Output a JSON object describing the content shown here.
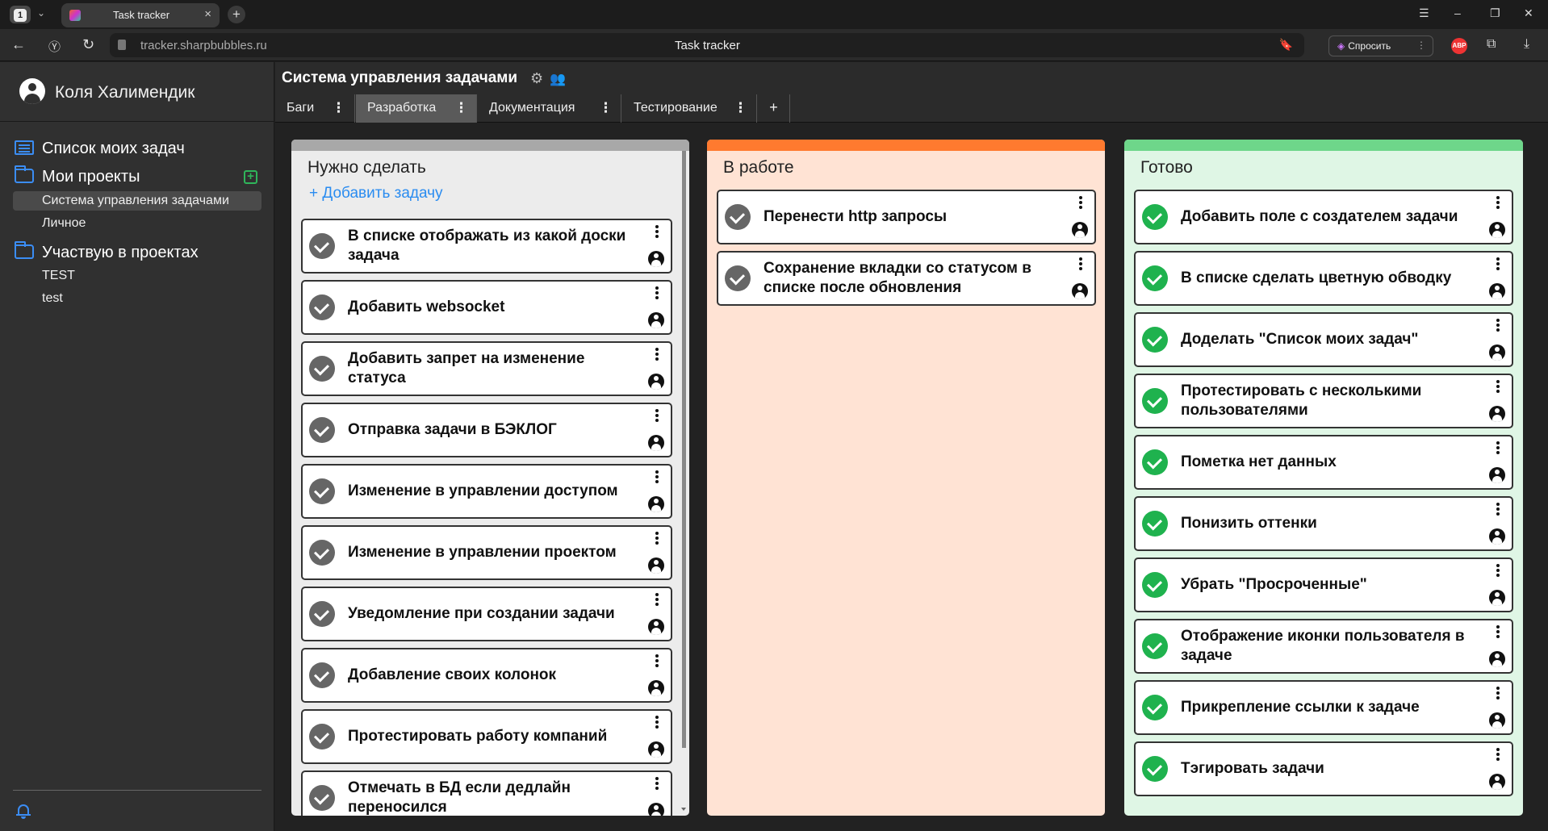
{
  "browser": {
    "tab_count": "1",
    "tab_title": "Task tracker",
    "url": "tracker.sharpbubbles.ru",
    "page_title": "Task tracker",
    "ask_button": "Спросить",
    "abp_badge": "ABP"
  },
  "sidebar": {
    "user_name": "Коля Халимендик",
    "my_tasks": "Список моих задач",
    "my_projects": "Мои проекты",
    "my_projects_items": [
      "Система управления задачами",
      "Личное"
    ],
    "participating": "Участвую в проектах",
    "participating_items": [
      "TEST",
      "test"
    ]
  },
  "header": {
    "project_title": "Система управления задачами",
    "tabs": [
      {
        "label": "Баги"
      },
      {
        "label": "Разработка"
      },
      {
        "label": "Документация"
      },
      {
        "label": "Тестирование"
      }
    ],
    "add_tab": "+",
    "active_tab": "Разработка"
  },
  "columns": [
    {
      "title": "Нужно сделать",
      "stripe_color": "#a8a8a8",
      "background": "#ececec",
      "add_task_label": "+ Добавить задачу",
      "check_color": "grey",
      "tasks": [
        "В списке отображать из какой доски задача",
        "Добавить websocket",
        "Добавить запрет на изменение статуса",
        "Отправка задачи в БЭКЛОГ",
        "Изменение в управлении доступом",
        "Изменение в управлении проектом",
        "Уведомление при создании задачи",
        "Добавление своих колонок",
        "Протестировать работу компаний",
        "Отмечать в БД если дедлайн переносился"
      ]
    },
    {
      "title": "В работе",
      "stripe_color": "#ff7a2f",
      "background": "#ffe3d4",
      "check_color": "grey",
      "tasks": [
        "Перенести http запросы",
        "Сохранение вкладки со статусом в списке после обновления"
      ]
    },
    {
      "title": "Готово",
      "stripe_color": "#6ed68a",
      "background": "#dff6e5",
      "check_color": "green",
      "tasks": [
        "Добавить поле с создателем задачи",
        "В списке сделать цветную обводку",
        "Доделать \"Список моих задач\"",
        "Протестировать с несколькими пользователями",
        "Пометка нет данных",
        "Понизить оттенки",
        "Убрать \"Просроченные\"",
        "Отображение иконки пользователя в задаче",
        "Прикрепление ссылки к задаче",
        "Тэгировать задачи"
      ]
    }
  ]
}
